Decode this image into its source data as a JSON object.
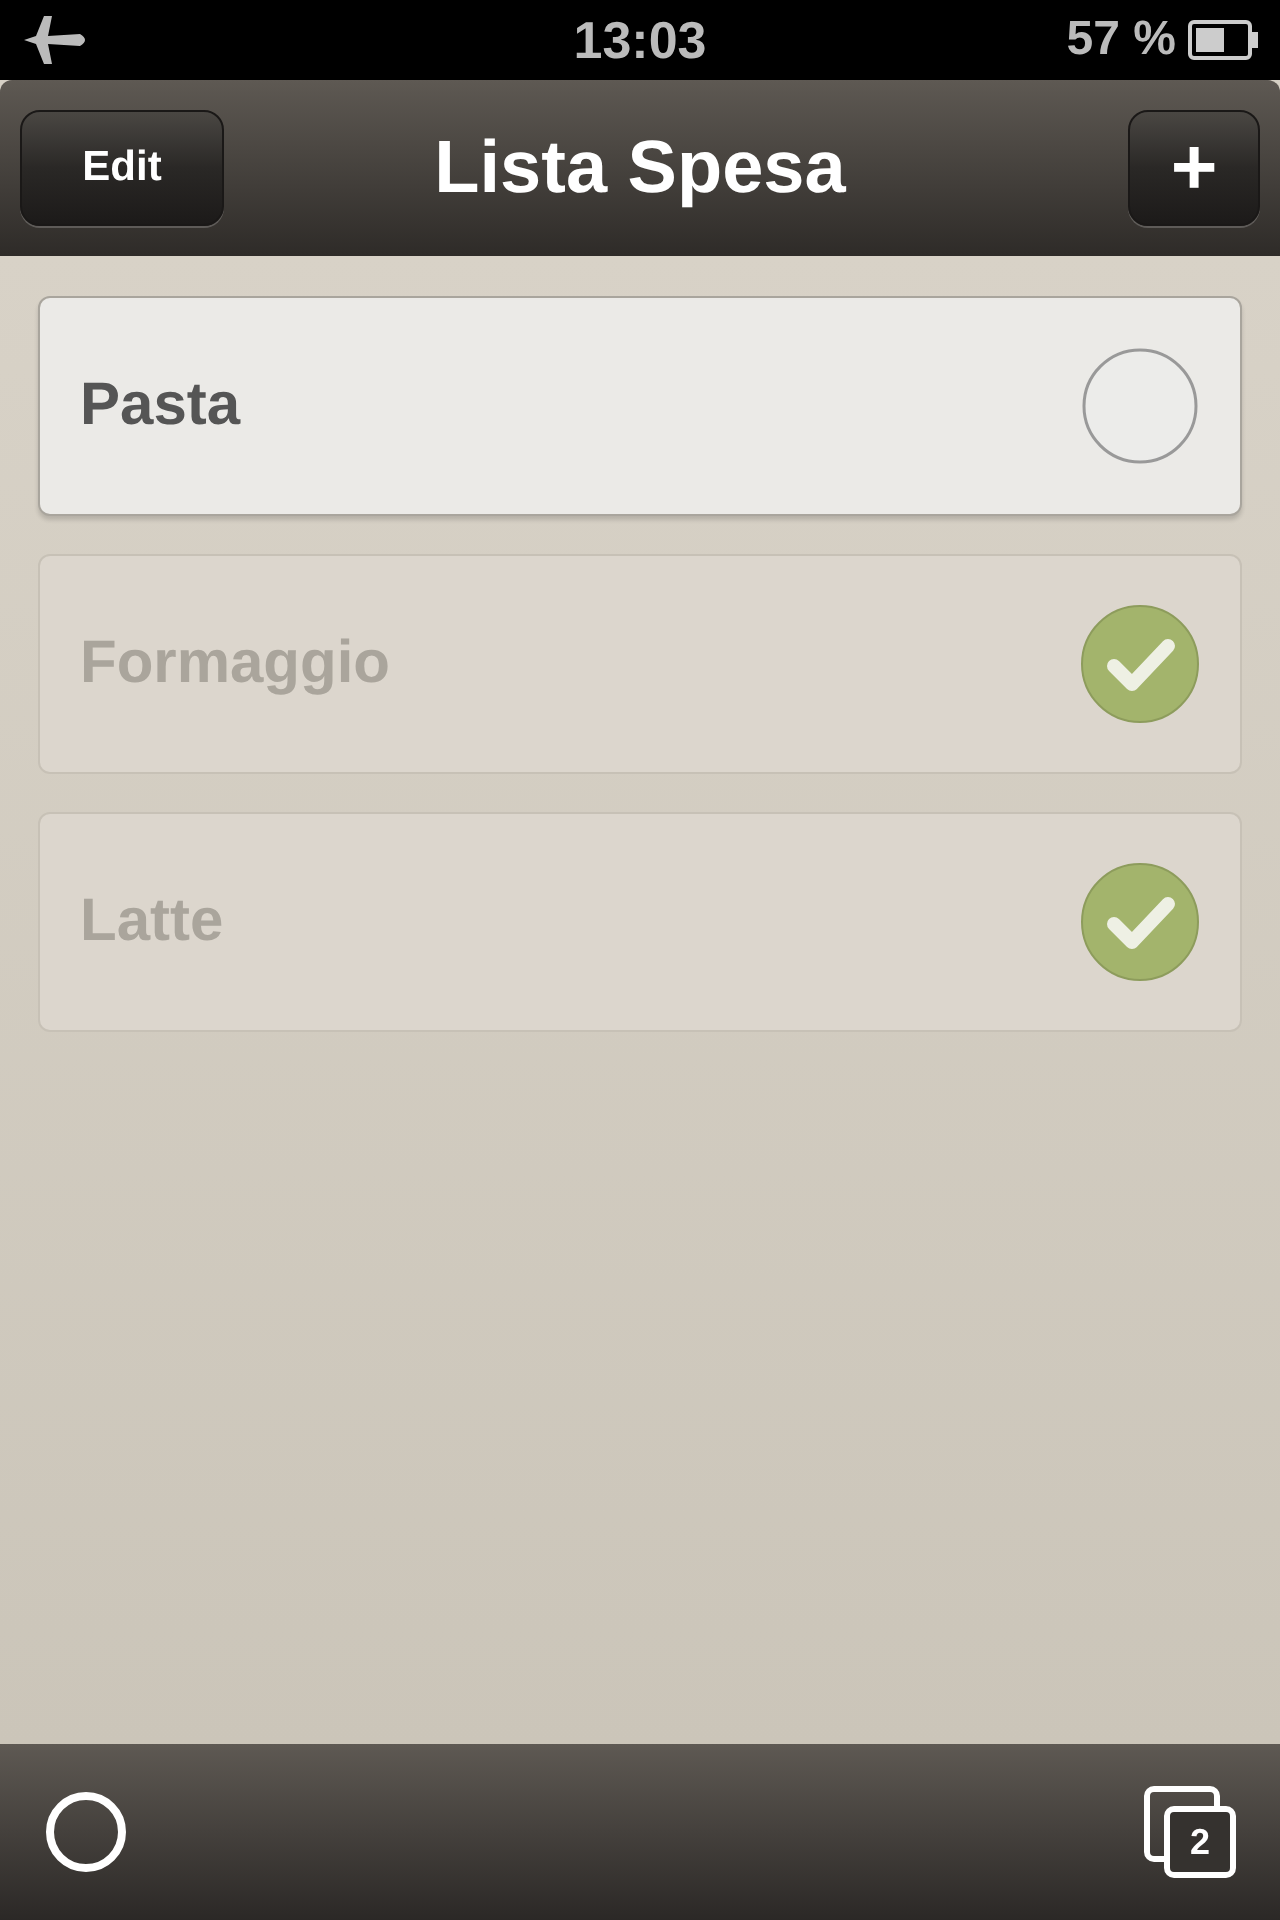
{
  "status_bar": {
    "time": "13:03",
    "battery": "57 %"
  },
  "nav_bar": {
    "title": "Lista Spesa",
    "edit_button": "Edit",
    "add_button": "+"
  },
  "items": [
    {
      "label": "Pasta",
      "checked": false
    },
    {
      "label": "Formaggio",
      "checked": true
    },
    {
      "label": "Latte",
      "checked": true
    }
  ],
  "toolbar": {
    "pages_count": "2"
  }
}
